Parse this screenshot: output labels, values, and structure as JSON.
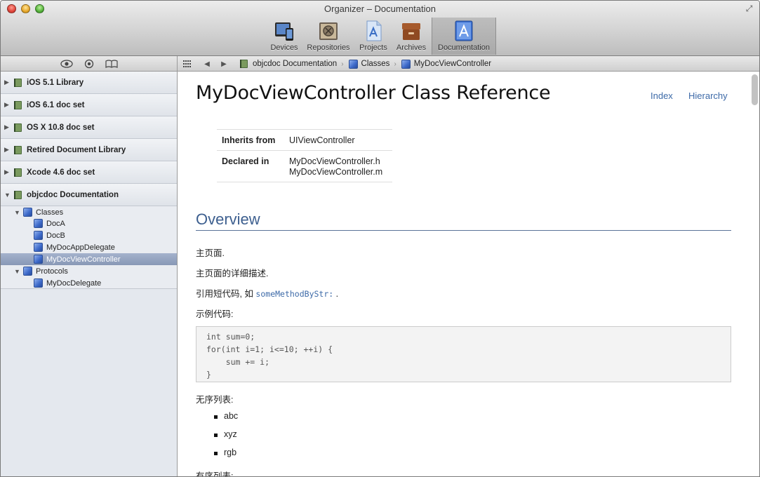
{
  "window": {
    "title": "Organizer – Documentation"
  },
  "toolbar": {
    "items": [
      {
        "label": "Devices",
        "icon": "devices-icon"
      },
      {
        "label": "Repositories",
        "icon": "repositories-icon"
      },
      {
        "label": "Projects",
        "icon": "projects-icon"
      },
      {
        "label": "Archives",
        "icon": "archives-icon"
      },
      {
        "label": "Documentation",
        "icon": "documentation-icon",
        "selected": true
      }
    ]
  },
  "breadcrumb": [
    "objcdoc Documentation",
    "Classes",
    "MyDocViewController"
  ],
  "sidebar": {
    "libraries": [
      "iOS 5.1 Library",
      "iOS 6.1 doc set",
      "OS X 10.8 doc set",
      "Retired Document Library",
      "Xcode 4.6 doc set",
      "objcdoc Documentation"
    ],
    "tree": [
      {
        "label": "Classes",
        "level": 1,
        "expanded": true
      },
      {
        "label": "DocA",
        "level": 2
      },
      {
        "label": "DocB",
        "level": 2
      },
      {
        "label": "MyDocAppDelegate",
        "level": 2
      },
      {
        "label": "MyDocViewController",
        "level": 2,
        "selected": true
      },
      {
        "label": "Protocols",
        "level": 1,
        "expanded": true
      },
      {
        "label": "MyDocDelegate",
        "level": 2
      }
    ]
  },
  "content": {
    "title": "MyDocViewController Class Reference",
    "links": {
      "index": "Index",
      "hierarchy": "Hierarchy"
    },
    "spec": {
      "inherits_label": "Inherits from",
      "inherits_value": "UIViewController",
      "declared_label": "Declared in",
      "declared_values": [
        "MyDocViewController.h",
        "MyDocViewController.m"
      ]
    },
    "overview_heading": "Overview",
    "para1": "主页面.",
    "para2": "主页面的详细描述.",
    "para3_prefix": "引用短代码, 如 ",
    "para3_code": "someMethodByStr:",
    "para3_suffix": " .",
    "para4": "示例代码:",
    "code_lines": [
      "int sum=0;",
      "for(int i=1; i<=10; ++i) {",
      "    sum += i;",
      "}"
    ],
    "unordered_label": "无序列表:",
    "unordered_items": [
      "abc",
      "xyz",
      "rgb"
    ],
    "ordered_label": "有序列表:"
  },
  "colors": {
    "link": "#3d6aa8",
    "heading": "#3d5f8f",
    "selection": "#8898b6"
  }
}
